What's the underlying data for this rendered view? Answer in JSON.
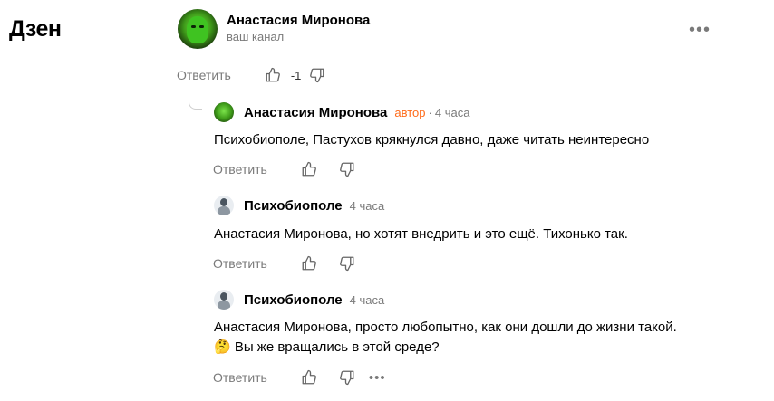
{
  "brand": {
    "logo": "Дзен"
  },
  "channel": {
    "name": "Анастасия Миронова",
    "subtitle": "ваш канал"
  },
  "top_actions": {
    "reply_label": "Ответить",
    "score": "-1",
    "more": "•••"
  },
  "comments": [
    {
      "author": "Анастасия Миронова",
      "badge": "автор",
      "time": "4 часа",
      "text": "Психобиополе, Пастухов крякнулся давно, даже читать неинтересно",
      "reply_label": "Ответить"
    },
    {
      "author": "Психобиополе",
      "time": "4 часа",
      "text": "Анастасия Миронова, но хотят внедрить и это ещё. Тихонько так.",
      "reply_label": "Ответить"
    },
    {
      "author": "Психобиополе",
      "time": "4 часа",
      "text_line1": "Анастасия Миронова, просто любопытно, как они дошли до жизни такой.",
      "text_line2": "🤔 Вы же вращались в этой среде?",
      "reply_label": "Ответить",
      "more": "•••"
    }
  ],
  "icons": {
    "like": "thumbs-up-icon",
    "dislike": "thumbs-down-icon",
    "more": "more-dots-icon"
  },
  "colors": {
    "author_badge": "#ff6b1a",
    "muted": "#7a7a7a"
  }
}
